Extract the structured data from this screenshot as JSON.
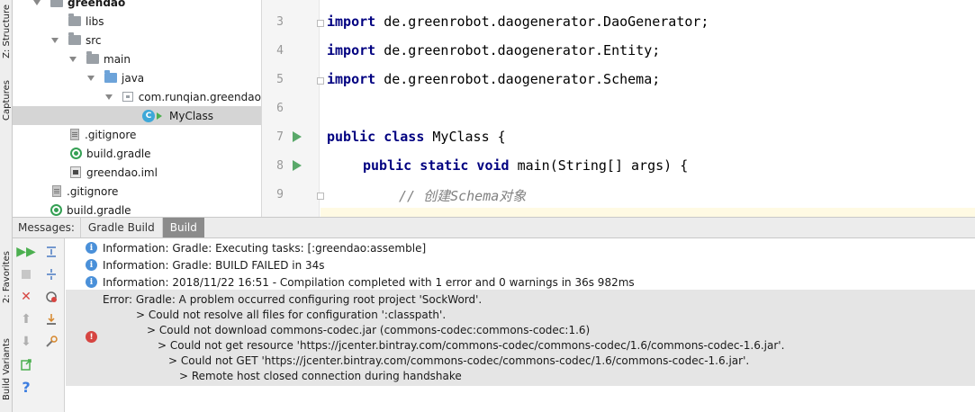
{
  "side_tabs": {
    "structure": "Z: Structure",
    "captures": "Captures",
    "favorites": "2: Favorites",
    "build_variants": "Build Variants"
  },
  "tree": {
    "items": [
      {
        "label": "greendao",
        "icon": "folder-icon",
        "expanded": true
      },
      {
        "label": "libs",
        "icon": "folder-icon"
      },
      {
        "label": "src",
        "icon": "folder-icon",
        "expanded": true
      },
      {
        "label": "main",
        "icon": "folder-icon",
        "expanded": true
      },
      {
        "label": "java",
        "icon": "source-folder-icon",
        "expanded": true
      },
      {
        "label": "com.runqian.greendao",
        "icon": "package-icon",
        "expanded": true
      },
      {
        "label": "MyClass",
        "icon": "java-class-icon",
        "selected": true
      },
      {
        "label": ".gitignore",
        "icon": "text-file-icon"
      },
      {
        "label": "build.gradle",
        "icon": "gradle-icon"
      },
      {
        "label": "greendao.iml",
        "icon": "module-file-icon"
      },
      {
        "label": ".gitignore",
        "icon": "text-file-icon"
      },
      {
        "label": "build.gradle",
        "icon": "gradle-icon"
      }
    ]
  },
  "editor": {
    "lines": [
      {
        "num": "3",
        "kw": "import",
        "rest": " de.greenrobot.daogenerator.DaoGenerator;"
      },
      {
        "num": "4",
        "kw": "import",
        "rest": " de.greenrobot.daogenerator.Entity;"
      },
      {
        "num": "5",
        "kw": "import",
        "rest": " de.greenrobot.daogenerator.Schema;"
      },
      {
        "num": "6",
        "kw": "",
        "rest": ""
      },
      {
        "num": "7",
        "kw": "public class",
        "rest": " MyClass {"
      },
      {
        "num": "8",
        "kw": "public static void",
        "rest": " main(String[] args) {"
      },
      {
        "num": "9",
        "comment": "// 创建Schema对象"
      }
    ]
  },
  "messages": {
    "label": "Messages:",
    "tabs": [
      {
        "label": "Gradle Build",
        "active": false
      },
      {
        "label": "Build",
        "active": true
      }
    ],
    "info": [
      "Information: Gradle: Executing tasks: [:greendao:assemble]",
      "Information: Gradle: BUILD FAILED in 34s",
      "Information: 2018/11/22 16:51 - Compilation completed with 1 error and 0 warnings in 36s 982ms"
    ],
    "error": [
      "Error: Gradle: A problem occurred configuring root project 'SockWord'.",
      "> Could not resolve all files for configuration ':classpath'.",
      "> Could not download commons-codec.jar (commons-codec:commons-codec:1.6)",
      "> Could not get resource 'https://jcenter.bintray.com/commons-codec/commons-codec/1.6/commons-codec-1.6.jar'.",
      "> Could not GET 'https://jcenter.bintray.com/commons-codec/commons-codec/1.6/commons-codec-1.6.jar'.",
      "> Remote host closed connection during handshake"
    ]
  },
  "colors": {
    "keyword": "#000080",
    "comment": "#808080",
    "info_icon": "#4a90d9",
    "error_icon": "#d64541",
    "run_icon": "#59a869"
  }
}
